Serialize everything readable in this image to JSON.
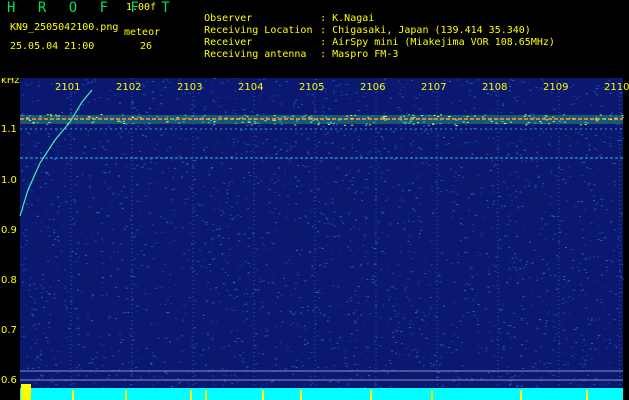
{
  "header": {
    "title": "H R O F F T",
    "version": "1.00f",
    "filename": "KN9_2505042100.png",
    "method": "meteor",
    "datetime": "25.05.04 21:00",
    "count": "26",
    "observer_label": "Observer",
    "observer_value": "K.Nagai",
    "location_label": "Receiving Location",
    "location_value": "Chigasaki, Japan (139.414 35.340)",
    "receiver_label": "Receiver",
    "receiver_value": "AirSpy mini (Miakejima VOR 108.65MHz)",
    "antenna_label": "Receiving antenna",
    "antenna_value": "Maspro FM-3"
  },
  "axis": {
    "unit": "kHz",
    "y_ticks": [
      "1.1",
      "1.0",
      "0.9",
      "0.8",
      "0.7",
      "0.6"
    ],
    "x_ticks": [
      "2101",
      "2102",
      "2103",
      "2104",
      "2105",
      "2106",
      "2107",
      "2108",
      "2109",
      "2110"
    ]
  },
  "colors": {
    "background": "#0a1870",
    "noise": "#1a3ab0",
    "carrier": "#ffa020",
    "text": "#ffff00",
    "bottom_bar": "#00ffff"
  }
}
